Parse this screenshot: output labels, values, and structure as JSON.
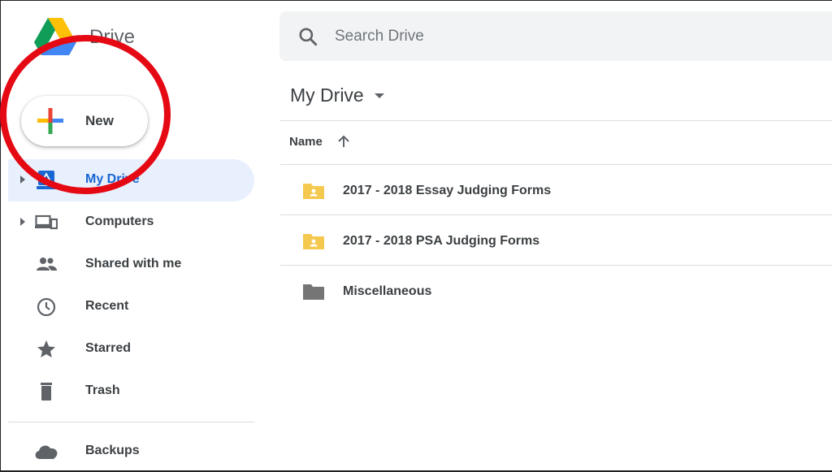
{
  "app": {
    "name": "Drive"
  },
  "search": {
    "placeholder": "Search Drive"
  },
  "new_button": {
    "label": "New"
  },
  "sidebar": {
    "items": [
      {
        "label": "My Drive",
        "icon": "my-drive-icon",
        "active": true
      },
      {
        "label": "Computers",
        "icon": "computers-icon"
      },
      {
        "label": "Shared with me",
        "icon": "shared-icon"
      },
      {
        "label": "Recent",
        "icon": "clock-icon"
      },
      {
        "label": "Starred",
        "icon": "star-icon"
      },
      {
        "label": "Trash",
        "icon": "trash-icon"
      },
      {
        "label": "Backups",
        "icon": "cloud-icon"
      }
    ]
  },
  "main": {
    "title": "My Drive",
    "columns": {
      "name": "Name"
    },
    "files": [
      {
        "name": "2017 - 2018 Essay Judging Forms",
        "type": "shared-folder"
      },
      {
        "name": "2017 - 2018 PSA Judging Forms",
        "type": "shared-folder"
      },
      {
        "name": "Miscellaneous",
        "type": "folder"
      }
    ]
  },
  "colors": {
    "accent": "#1967d2",
    "active_bg": "#e8f0fe",
    "shared_folder": "#f5c94f",
    "folder": "#757575",
    "annotation": "#e50914"
  }
}
